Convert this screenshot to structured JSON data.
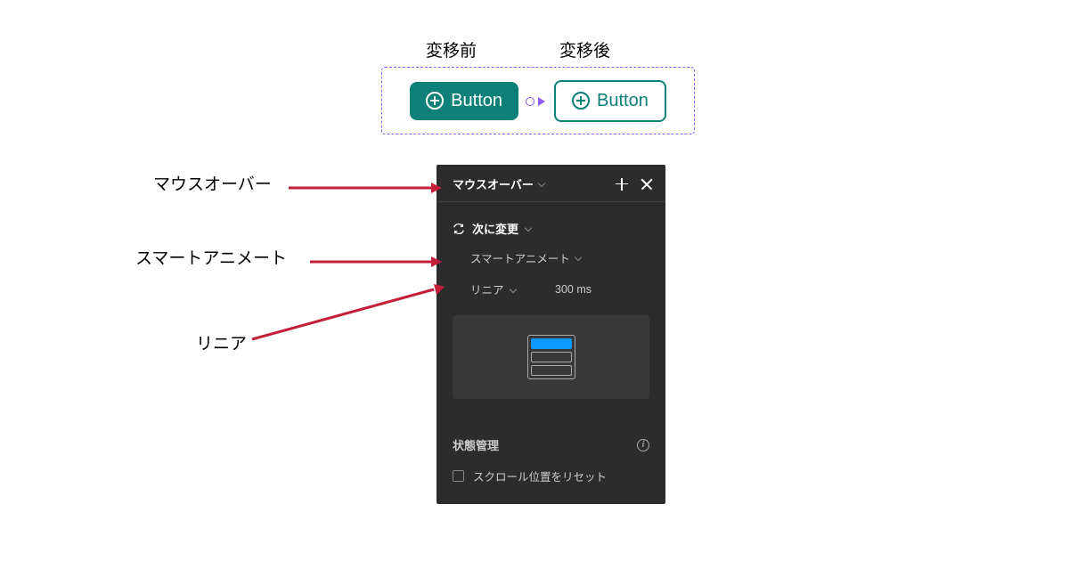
{
  "frame": {
    "label_before": "変移前",
    "label_after": "変移後",
    "button1_text": "Button",
    "button2_text": "Button"
  },
  "panel": {
    "trigger": "マウスオーバー",
    "action": "次に変更",
    "animation": "スマートアニメート",
    "easing": "リニア",
    "duration": "300 ms",
    "state_title": "状態管理",
    "reset_scroll": "スクロール位置をリセット"
  },
  "annotations": {
    "label1": "マウスオーバー",
    "label2": "スマートアニメート",
    "label3": "リニア"
  }
}
